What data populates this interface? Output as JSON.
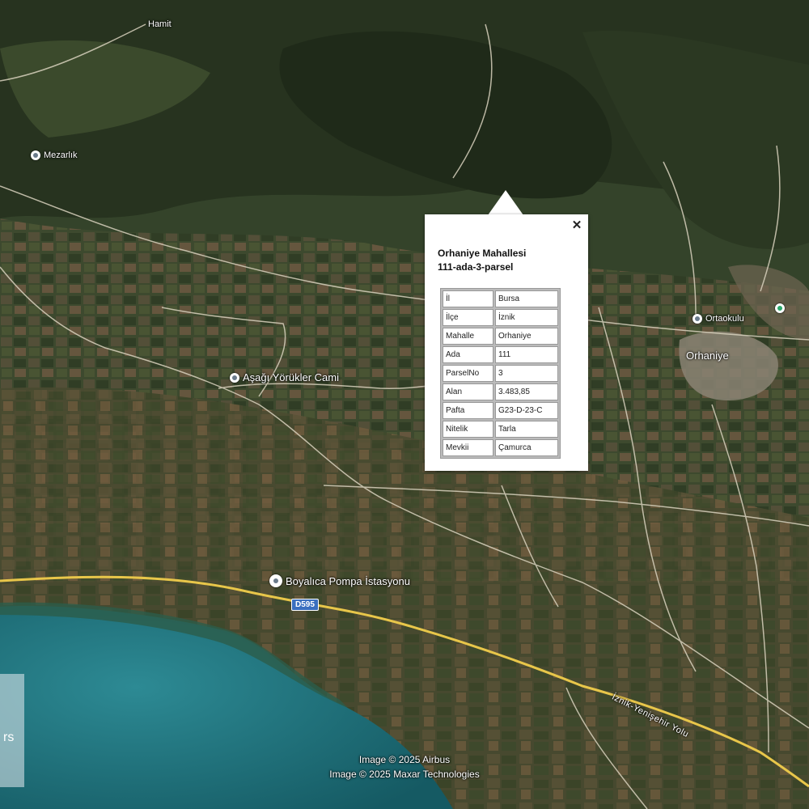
{
  "popup": {
    "title_line1": "Orhaniye Mahallesi",
    "title_line2": "111-ada-3-parsel",
    "close_label": "✕",
    "rows": [
      {
        "key": "İl",
        "value": "Bursa"
      },
      {
        "key": "İlçe",
        "value": "İznik"
      },
      {
        "key": "Mahalle",
        "value": "Orhaniye"
      },
      {
        "key": "Ada",
        "value": "111"
      },
      {
        "key": "ParselNo",
        "value": "3"
      },
      {
        "key": "Alan",
        "value": "3.483,85"
      },
      {
        "key": "Pafta",
        "value": "G23-D-23-C"
      },
      {
        "key": "Nitelik",
        "value": "Tarla"
      },
      {
        "key": "Mevkii",
        "value": "Çamurca"
      }
    ]
  },
  "places": {
    "mezarlik": "Mezarlık",
    "cami": "Aşağı Yörükler Cami",
    "pompa": "Boyalıca Pompa İstasyonu",
    "okul": "Ortaokulu",
    "orhaniye": "Orhaniye",
    "top_label": "Hamit"
  },
  "route": "D595",
  "street": "İznik-Yenişehir Yolu",
  "side_panel_text": "rs",
  "credits": {
    "line1": "Image © 2025 Airbus",
    "line2": "Image © 2025 Maxar Technologies"
  },
  "colors": {
    "road_main": "#e8c64a",
    "road_minor": "#d9d2bf",
    "lake": "#1f6f7a",
    "land_dark": "#2f3d25",
    "land_field": "#6b5a3c"
  }
}
